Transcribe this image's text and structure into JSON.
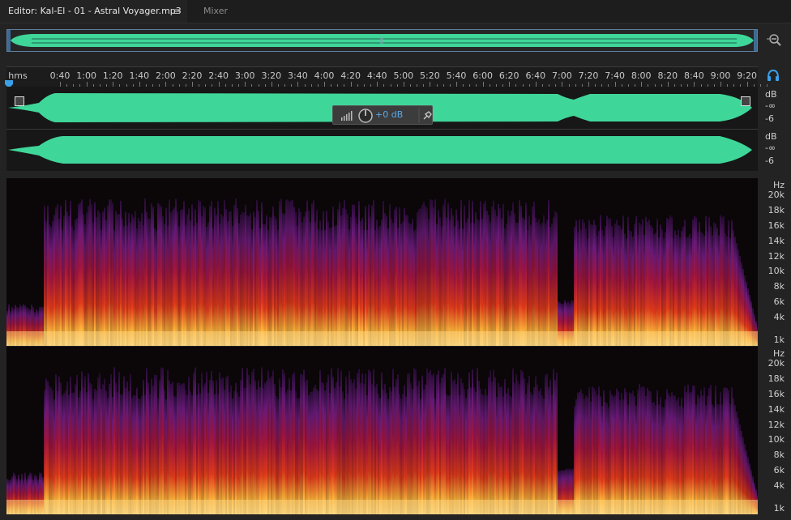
{
  "tabs": {
    "editor": "Editor: Kal-El - 01 - Astral Voyager.mp3",
    "editor_menu": "≡",
    "mixer": "Mixer"
  },
  "ruler": {
    "units": "hms",
    "labels": [
      "0:40",
      "1:00",
      "1:20",
      "1:40",
      "2:00",
      "2:20",
      "2:40",
      "3:00",
      "3:20",
      "3:40",
      "4:00",
      "4:20",
      "4:40",
      "5:00",
      "5:20",
      "5:40",
      "6:00",
      "6:20",
      "6:40",
      "7:00",
      "7:20",
      "7:40",
      "8:00",
      "8:20",
      "8:40",
      "9:00",
      "9:20"
    ]
  },
  "waveform": {
    "db_unit": "dB",
    "db_inf": "-∞",
    "db_minus6": "-6",
    "color": "#3fd69a"
  },
  "gain_hud": {
    "value": "+0 dB"
  },
  "spectrogram": {
    "unit": "Hz",
    "labels": [
      "20k",
      "18k",
      "16k",
      "14k",
      "12k",
      "10k",
      "8k",
      "6k",
      "4k",
      "1k"
    ]
  },
  "colors": {
    "accent": "#3aa0e8",
    "wave": "#3fd69a",
    "spec_hot": "#ffd37a",
    "spec_mid": "#e23a1a",
    "spec_low": "#6a1a7a"
  }
}
